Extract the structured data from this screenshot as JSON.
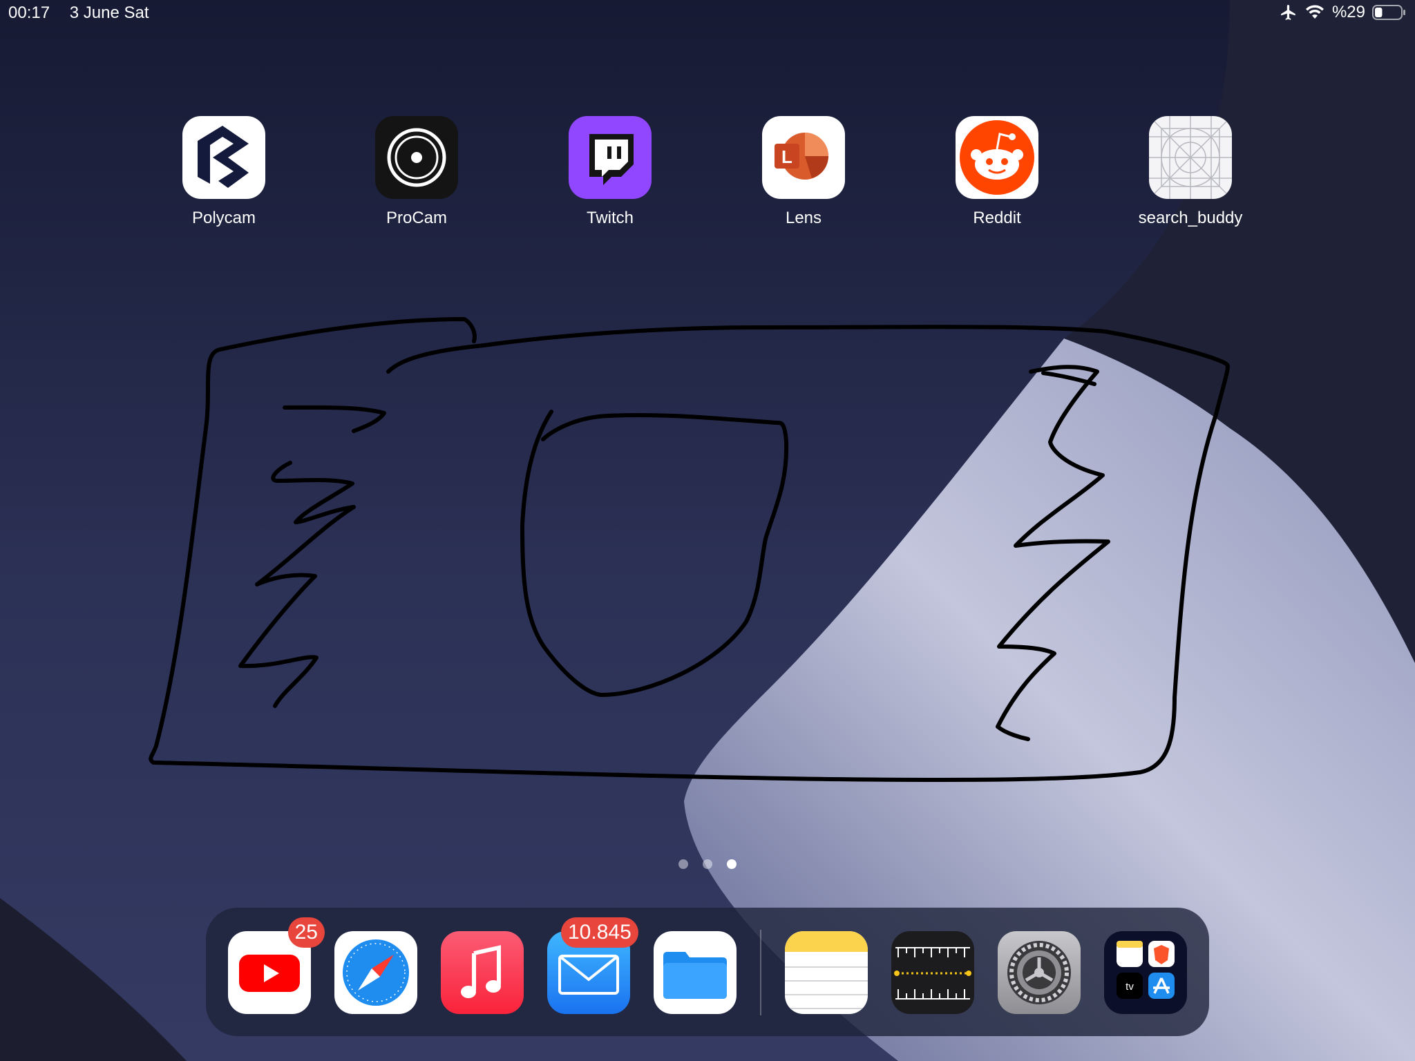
{
  "status_bar": {
    "time": "00:17",
    "date": "3 June Sat",
    "battery": "%29",
    "icons": [
      "airplane-mode-icon",
      "wifi-icon",
      "battery-icon"
    ],
    "battery_level": 0.29
  },
  "home_apps": [
    {
      "label": "Polycam",
      "icon": "polycam-icon"
    },
    {
      "label": "ProCam",
      "icon": "procam-icon"
    },
    {
      "label": "Twitch",
      "icon": "twitch-icon"
    },
    {
      "label": "Lens",
      "icon": "lens-icon"
    },
    {
      "label": "Reddit",
      "icon": "reddit-icon"
    },
    {
      "label": "search_buddy",
      "icon": "placeholder-app-icon"
    }
  ],
  "page_indicator": {
    "pages": 3,
    "current": 3
  },
  "dock": {
    "apps": [
      {
        "icon": "youtube-icon",
        "badge": "25"
      },
      {
        "icon": "safari-icon"
      },
      {
        "icon": "music-icon"
      },
      {
        "icon": "mail-icon",
        "badge": "10.845"
      },
      {
        "icon": "files-icon"
      },
      {
        "icon": "notes-icon"
      },
      {
        "icon": "measure-icon"
      },
      {
        "icon": "settings-icon"
      },
      {
        "icon": "app-library-icon",
        "mini_labels": [
          "tv"
        ]
      }
    ]
  },
  "colors": {
    "twitch": "#9146ff",
    "reddit": "#ff4500",
    "badge": "#e8453c",
    "wallpaper_dark": "#1c1f38",
    "wallpaper_light": "#b9bdd6"
  }
}
